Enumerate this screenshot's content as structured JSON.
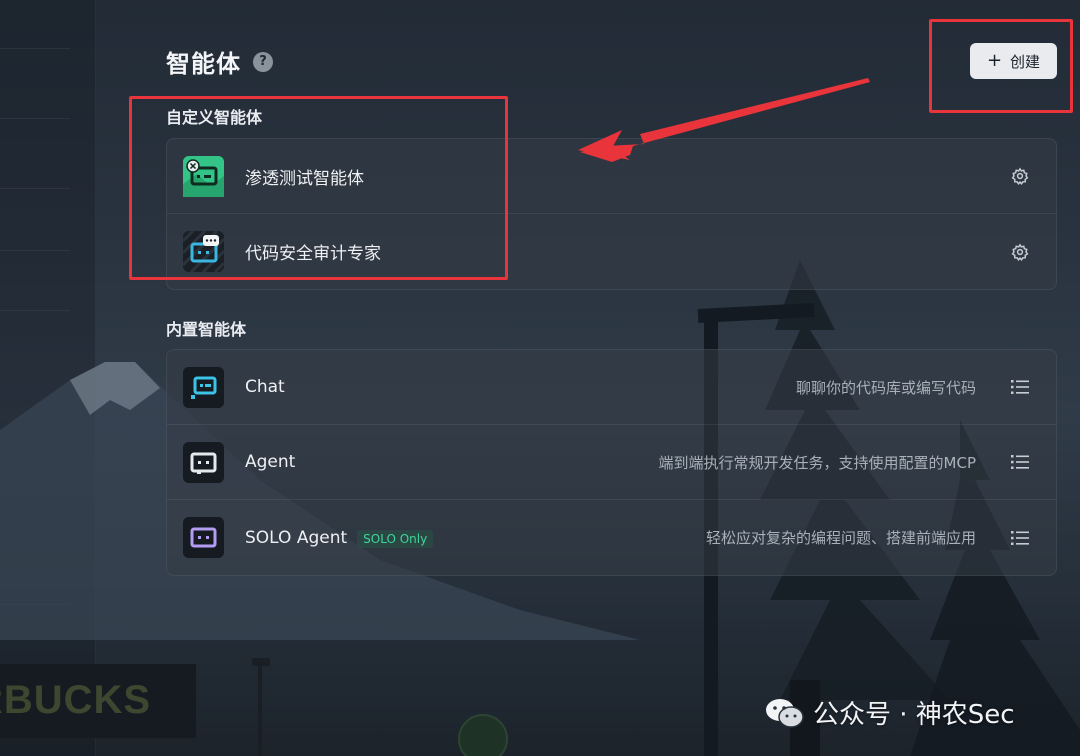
{
  "header": {
    "title": "智能体",
    "help_glyph": "?",
    "create_button": {
      "icon": "+",
      "label": "创建"
    }
  },
  "custom_section": {
    "title": "自定义智能体",
    "items": [
      {
        "name": "渗透测试智能体",
        "icon": "pentest-agent-icon",
        "action_icon": "gear-icon"
      },
      {
        "name": "代码安全审计专家",
        "icon": "code-audit-agent-icon",
        "action_icon": "gear-icon"
      }
    ]
  },
  "builtin_section": {
    "title": "内置智能体",
    "items": [
      {
        "name": "Chat",
        "description": "聊聊你的代码库或编写代码",
        "icon": "chat-agent-icon",
        "action_icon": "list-icon"
      },
      {
        "name": "Agent",
        "description": "端到端执行常规开发任务，支持使用配置的MCP",
        "icon": "agent-icon",
        "action_icon": "list-icon"
      },
      {
        "name": "SOLO Agent",
        "badge": "SOLO Only",
        "description": "轻松应对复杂的编程问题、搭建前端应用",
        "icon": "solo-agent-icon",
        "action_icon": "list-icon"
      }
    ]
  },
  "background": {
    "sign_text": "RBUCKS"
  },
  "watermark": {
    "text": "公众号 · 神农Sec"
  },
  "colors": {
    "annotation": "#e8343a",
    "badge_green": "#3fd59a",
    "button_bg": "#e9ebee"
  }
}
